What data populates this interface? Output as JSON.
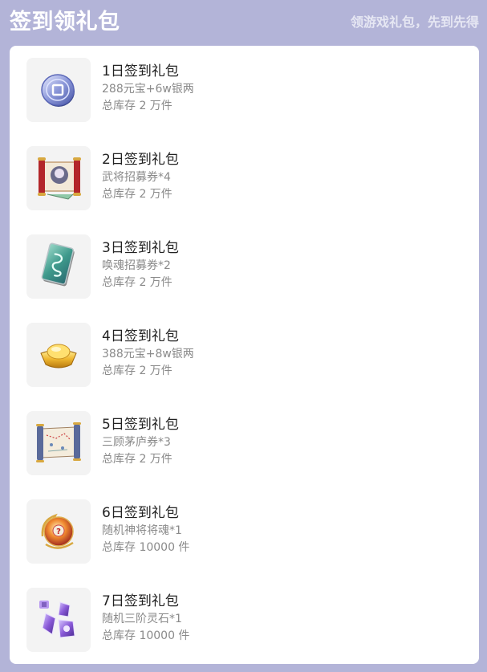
{
  "header": {
    "title": "签到领礼包",
    "slogan": "领游戏礼包，先到先得"
  },
  "gifts": [
    {
      "name": "1日签到礼包",
      "desc": "288元宝+6w银两",
      "stock": "总库存 2 万件",
      "icon": "silver-coin-icon"
    },
    {
      "name": "2日签到礼包",
      "desc": "武将招募券*4",
      "stock": "总库存 2 万件",
      "icon": "recruit-scroll-icon"
    },
    {
      "name": "3日签到礼包",
      "desc": "唤魂招募券*2",
      "stock": "总库存 2 万件",
      "icon": "jade-card-icon"
    },
    {
      "name": "4日签到礼包",
      "desc": "388元宝+8w银两",
      "stock": "总库存 2 万件",
      "icon": "gold-ingot-icon"
    },
    {
      "name": "5日签到礼包",
      "desc": "三顾茅庐券*3",
      "stock": "总库存 2 万件",
      "icon": "map-scroll-icon"
    },
    {
      "name": "6日签到礼包",
      "desc": "随机神将将魂*1",
      "stock": "总库存 10000 件",
      "icon": "mystery-orb-icon"
    },
    {
      "name": "7日签到礼包",
      "desc": "随机三阶灵石*1",
      "stock": "总库存 10000 件",
      "icon": "spirit-stone-icon"
    }
  ],
  "colors": {
    "background": "#b3b4d8",
    "card": "#ffffff",
    "thumb_bg": "#f3f3f3",
    "title_text": "#222222",
    "sub_text": "#8a8a8a"
  }
}
